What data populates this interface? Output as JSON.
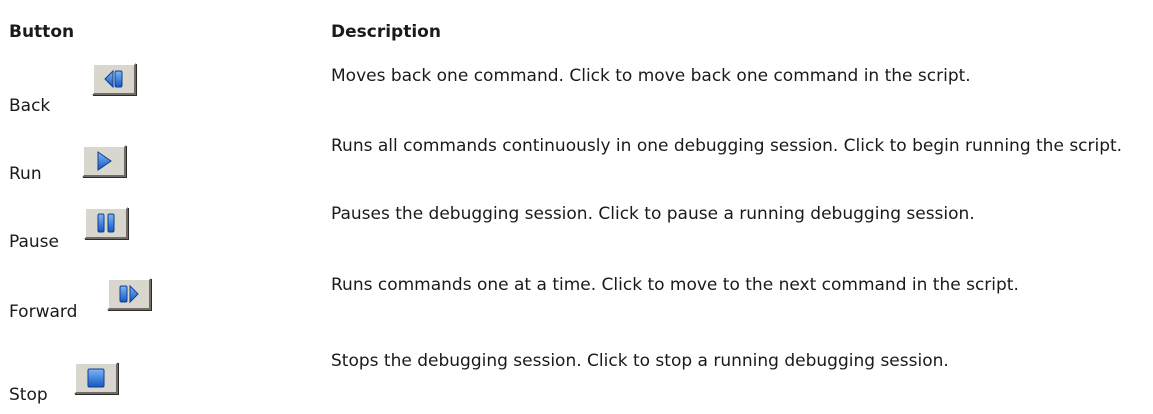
{
  "headers": {
    "button": "Button",
    "description": "Description"
  },
  "rows": [
    {
      "label": "Back",
      "icon": "back-icon",
      "description": "Moves back one command. Click to move back one command in the script."
    },
    {
      "label": "Run",
      "icon": "run-icon",
      "description": "Runs all commands continuously in one debugging session. Click to begin running the script."
    },
    {
      "label": "Pause",
      "icon": "pause-icon",
      "description": "Pauses the debugging session. Click to pause a running debugging session."
    },
    {
      "label": "Forward",
      "icon": "forward-icon",
      "description": "Runs commands one at a time. Click to move to the next command in the script."
    },
    {
      "label": "Stop",
      "icon": "stop-icon",
      "description": "Stops the debugging session. Click to stop a running debugging session."
    }
  ],
  "colors": {
    "icon_blue": "#1e6fd9",
    "icon_blue_light": "#7fb6f5",
    "button_face": "#d8d6cd"
  }
}
